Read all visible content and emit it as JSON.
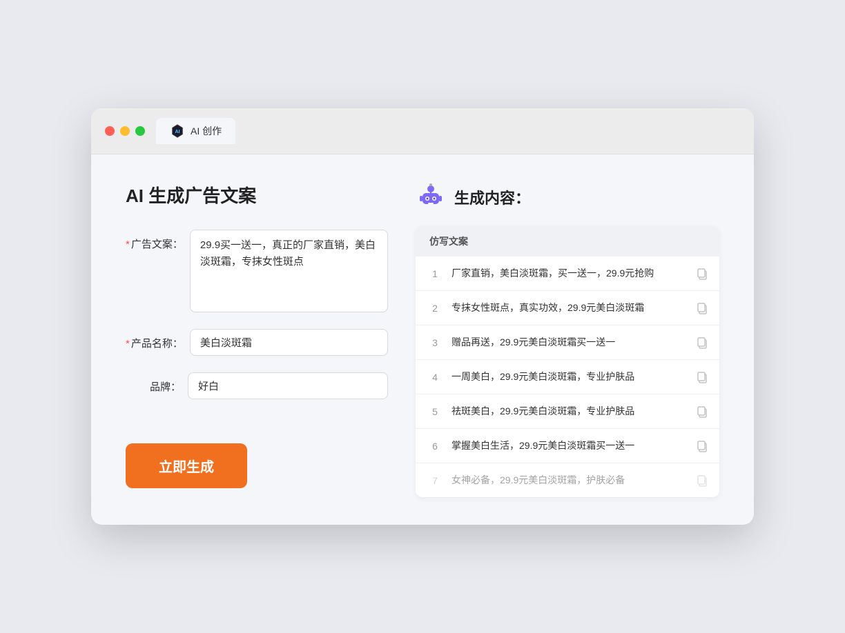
{
  "window": {
    "tab_label": "AI 创作"
  },
  "page": {
    "title": "AI 生成广告文案",
    "result_title": "生成内容："
  },
  "form": {
    "ad_copy_label": "广告文案：",
    "ad_copy_value": "29.9买一送一，真正的厂家直销，美白淡斑霜，专抹女性斑点",
    "product_name_label": "产品名称：",
    "product_name_value": "美白淡斑霜",
    "brand_label": "品牌：",
    "brand_value": "好白",
    "generate_btn": "立即生成"
  },
  "results": {
    "table_header": "仿写文案",
    "items": [
      {
        "num": 1,
        "text": "厂家直销，美白淡斑霜，买一送一，29.9元抢购",
        "dimmed": false
      },
      {
        "num": 2,
        "text": "专抹女性斑点，真实功效，29.9元美白淡斑霜",
        "dimmed": false
      },
      {
        "num": 3,
        "text": "赠品再送，29.9元美白淡斑霜买一送一",
        "dimmed": false
      },
      {
        "num": 4,
        "text": "一周美白，29.9元美白淡斑霜，专业护肤品",
        "dimmed": false
      },
      {
        "num": 5,
        "text": "祛斑美白，29.9元美白淡斑霜，专业护肤品",
        "dimmed": false
      },
      {
        "num": 6,
        "text": "掌握美白生活，29.9元美白淡斑霜买一送一",
        "dimmed": false
      },
      {
        "num": 7,
        "text": "女神必备，29.9元美白淡斑霜，护肤必备",
        "dimmed": true
      }
    ]
  },
  "colors": {
    "accent": "#f07020",
    "required": "#ff4d4f"
  }
}
